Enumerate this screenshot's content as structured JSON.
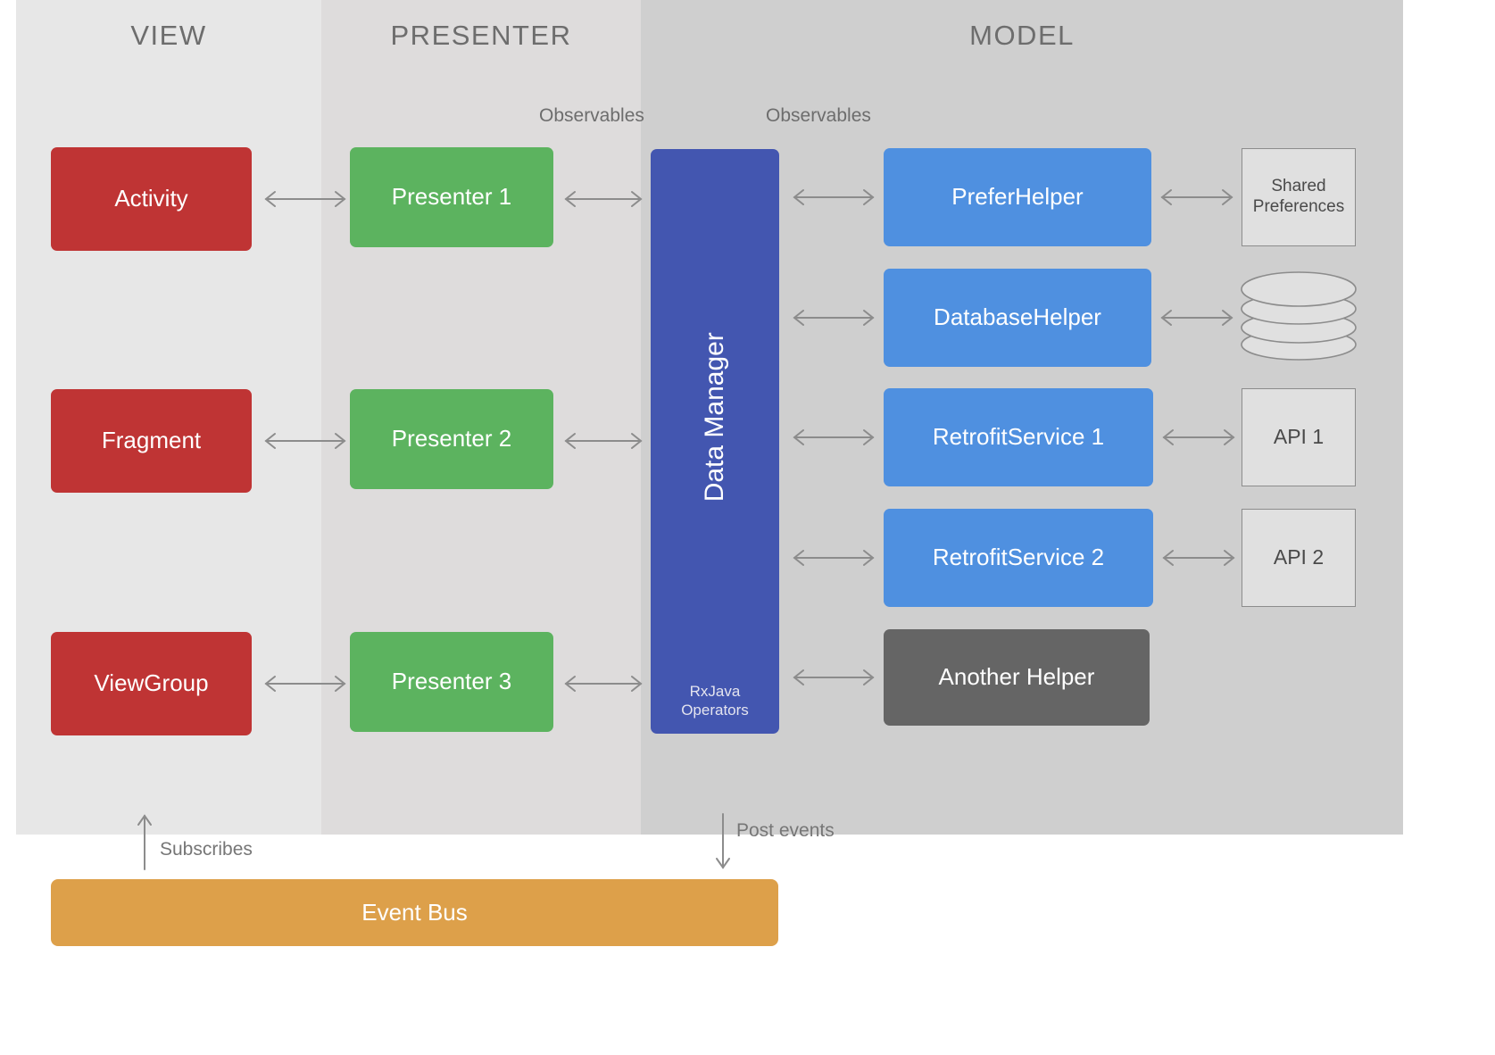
{
  "bands": [
    {
      "id": "view",
      "title": "VIEW",
      "color": "#e7e7e7"
    },
    {
      "id": "presenter",
      "title": "PRESENTER",
      "color": "#dedcdc"
    },
    {
      "id": "model",
      "title": "MODEL",
      "color": "#cfcfcf"
    }
  ],
  "view_nodes": [
    {
      "label": "Activity",
      "color": "#bf3434"
    },
    {
      "label": "Fragment",
      "color": "#bf3434"
    },
    {
      "label": "ViewGroup",
      "color": "#bf3434"
    }
  ],
  "presenter_nodes": [
    {
      "label": "Presenter 1",
      "color": "#5cb35f"
    },
    {
      "label": "Presenter 2",
      "color": "#5cb35f"
    },
    {
      "label": "Presenter 3",
      "color": "#5cb35f"
    }
  ],
  "data_manager": {
    "label": "Data Manager",
    "sublabel_line1": "RxJava",
    "sublabel_line2": "Operators",
    "color": "#4356b0"
  },
  "model_nodes": [
    {
      "label": "PreferHelper",
      "color": "#4f90e0"
    },
    {
      "label": "DatabaseHelper",
      "color": "#4f90e0"
    },
    {
      "label": "RetrofitService 1",
      "color": "#4f90e0"
    },
    {
      "label": "RetrofitService 2",
      "color": "#4f90e0"
    },
    {
      "label": "Another Helper",
      "color": "#656565"
    }
  ],
  "external_nodes": [
    {
      "label_line1": "Shared",
      "label_line2": "Preferences",
      "shape": "rect"
    },
    {
      "label_line1": "",
      "label_line2": "",
      "shape": "cylinder"
    },
    {
      "label_line1": "API 1",
      "label_line2": "",
      "shape": "rect"
    },
    {
      "label_line1": "API 2",
      "label_line2": "",
      "shape": "rect"
    }
  ],
  "edge_labels": {
    "observables_left": "Observables",
    "observables_right": "Observables"
  },
  "event_bus": {
    "label": "Event Bus",
    "color": "#dda04a",
    "subscribes_label": "Subscribes",
    "post_events_label": "Post events"
  },
  "arrow_color": "#8c8c8c"
}
